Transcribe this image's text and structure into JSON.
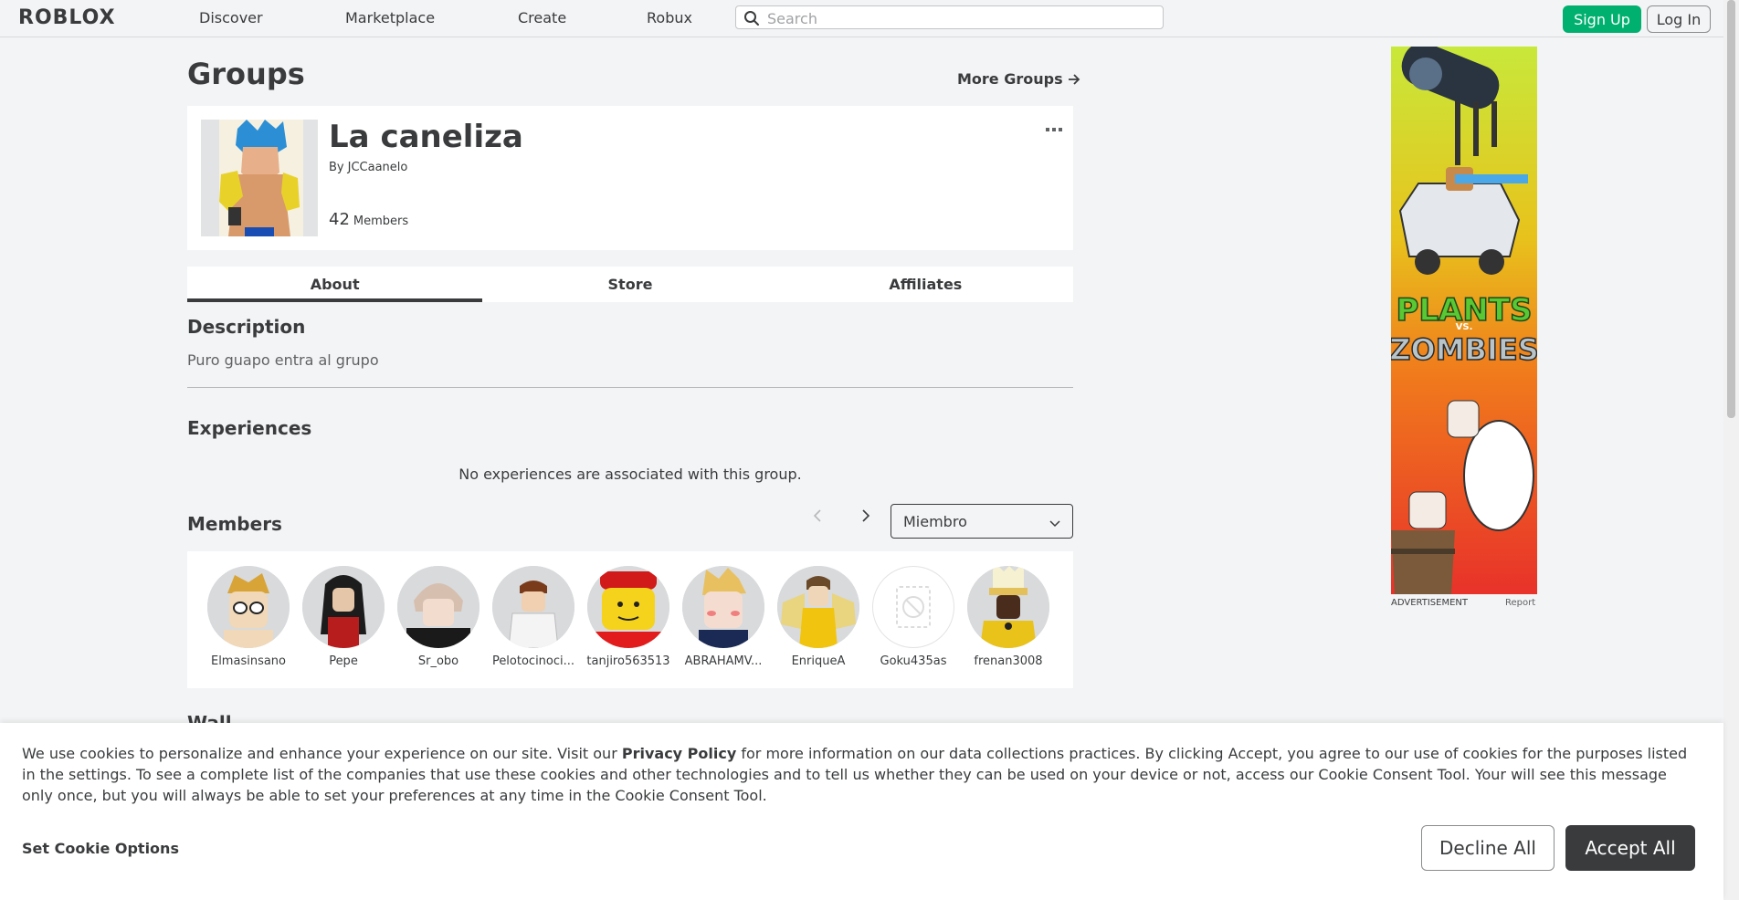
{
  "header": {
    "logo_text": "ROBLOX",
    "nav": [
      {
        "label": "Discover"
      },
      {
        "label": "Marketplace"
      },
      {
        "label": "Create"
      },
      {
        "label": "Robux"
      }
    ],
    "search_placeholder": "Search",
    "signup_label": "Sign Up",
    "login_label": "Log In"
  },
  "page": {
    "title": "Groups",
    "more_groups_label": "More Groups"
  },
  "group": {
    "name": "La caneliza",
    "owner_prefix": "By",
    "owner_name": "JCCaanelo",
    "member_count": "42",
    "member_label": "Members",
    "more_icon_glyph": "•••"
  },
  "tabs": [
    {
      "label": "About",
      "active": true
    },
    {
      "label": "Store",
      "active": false
    },
    {
      "label": "Affiliates",
      "active": false
    }
  ],
  "description": {
    "title": "Description",
    "text": "Puro guapo entra al grupo"
  },
  "experiences": {
    "title": "Experiences",
    "empty_text": "No experiences are associated with this group."
  },
  "members": {
    "title": "Members",
    "role_selected": "Miembro",
    "list": [
      {
        "name": "Elmasinsano"
      },
      {
        "name": "Pepe"
      },
      {
        "name": "Sr_obo"
      },
      {
        "name": "Pelotocinoci..."
      },
      {
        "name": "tanjiro563513"
      },
      {
        "name": "ABRAHAMV..."
      },
      {
        "name": "EnriqueA"
      },
      {
        "name": "Goku435as"
      },
      {
        "name": "frenan3008"
      }
    ]
  },
  "wall": {
    "title": "Wall"
  },
  "ad": {
    "label": "ADVERTISEMENT",
    "report_label": "Report",
    "banner_text_1": "PLANTS",
    "banner_text_2": "VS.",
    "banner_text_3": "ZOMBIES"
  },
  "cookie_banner": {
    "text_before_link": "We use cookies to personalize and enhance your experience on our site. Visit our ",
    "link_text": "Privacy Policy",
    "text_after_link": " for more information on our data collections practices. By clicking Accept, you agree to our use of cookies for the purposes listed in the settings. To see a complete list of the companies that use these cookies and other technologies and to tell us whether they can be used on your device or not, access our Cookie Consent Tool. Your will see this message only once, but you will always be able to set your preferences at any time in the Cookie Consent Tool.",
    "options_label": "Set Cookie Options",
    "decline_label": "Decline All",
    "accept_label": "Accept All"
  },
  "colors": {
    "background": "#f2f4f5",
    "signup_green": "#00b06f",
    "text_dark": "#393b3d",
    "accept_dark": "#393b3d"
  }
}
